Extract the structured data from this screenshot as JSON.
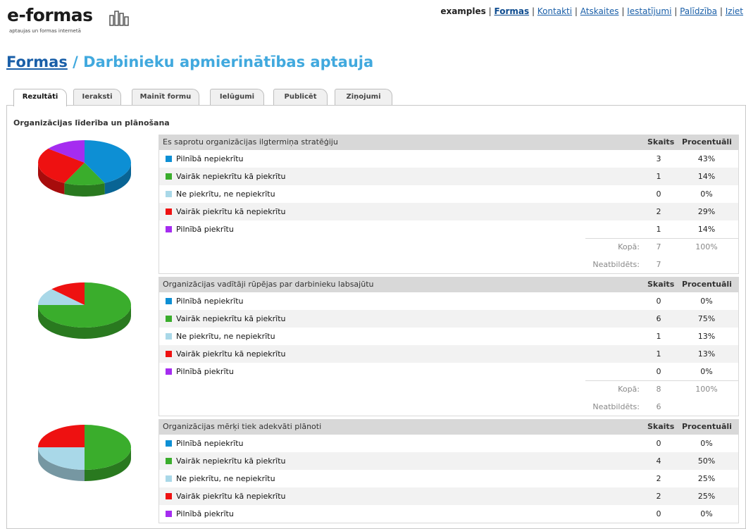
{
  "header": {
    "logo_text": "e-formas",
    "logo_tagline": "aptaujas un formas internetā",
    "nav_plain": "examples",
    "nav": [
      {
        "label": "Formas",
        "active": true
      },
      {
        "label": "Kontakti"
      },
      {
        "label": "Atskaites"
      },
      {
        "label": "Iestatījumi"
      },
      {
        "label": "Palīdzība"
      },
      {
        "label": "Iziet"
      }
    ]
  },
  "page": {
    "breadcrumb_link": "Formas",
    "separator": " / ",
    "title": "Darbinieku apmierinātības aptauja"
  },
  "tabs": [
    "Rezultāti",
    "Ieraksti",
    "Mainīt formu",
    "Ielūgumi",
    "Publicēt",
    "Ziņojumi"
  ],
  "section_title": "Organizācijas līderība un plānošana",
  "columns": {
    "count": "Skaits",
    "percent": "Procentuāli"
  },
  "totals_labels": {
    "total": "Kopā:",
    "unanswered": "Neatbildēts:"
  },
  "answer_colors": [
    "#0d8fd4",
    "#3aad2c",
    "#a9d8e8",
    "#ee1111",
    "#a52cf0"
  ],
  "questions": [
    {
      "title": "Es saprotu organizācijas ilgtermiņa stratēģiju",
      "answers": [
        {
          "label": "Pilnībā nepiekrītu",
          "count": "3",
          "percent": "43%"
        },
        {
          "label": "Vairāk nepiekrītu kā piekrītu",
          "count": "1",
          "percent": "14%"
        },
        {
          "label": "Ne piekrītu, ne nepiekrītu",
          "count": "0",
          "percent": "0%"
        },
        {
          "label": "Vairāk piekrītu kā nepiekrītu",
          "count": "2",
          "percent": "29%"
        },
        {
          "label": "Pilnībā piekrītu",
          "count": "1",
          "percent": "14%"
        }
      ],
      "total": "7",
      "total_percent": "100%",
      "unanswered": "7"
    },
    {
      "title": "Organizācijas vadītāji rūpējas par darbinieku labsajūtu",
      "answers": [
        {
          "label": "Pilnībā nepiekrītu",
          "count": "0",
          "percent": "0%"
        },
        {
          "label": "Vairāk nepiekrītu kā piekrītu",
          "count": "6",
          "percent": "75%"
        },
        {
          "label": "Ne piekrītu, ne nepiekrītu",
          "count": "1",
          "percent": "13%"
        },
        {
          "label": "Vairāk piekrītu kā nepiekrītu",
          "count": "1",
          "percent": "13%"
        },
        {
          "label": "Pilnībā piekrītu",
          "count": "0",
          "percent": "0%"
        }
      ],
      "total": "8",
      "total_percent": "100%",
      "unanswered": "6"
    },
    {
      "title": "Organizācijas mērķi tiek adekvāti plānoti",
      "answers": [
        {
          "label": "Pilnībā nepiekrītu",
          "count": "0",
          "percent": "0%"
        },
        {
          "label": "Vairāk nepiekrītu kā piekrītu",
          "count": "4",
          "percent": "50%"
        },
        {
          "label": "Ne piekrītu, ne nepiekrītu",
          "count": "2",
          "percent": "25%"
        },
        {
          "label": "Vairāk piekrītu kā nepiekrītu",
          "count": "2",
          "percent": "25%"
        },
        {
          "label": "Pilnībā piekrītu",
          "count": "0",
          "percent": "0%"
        }
      ]
    }
  ]
}
